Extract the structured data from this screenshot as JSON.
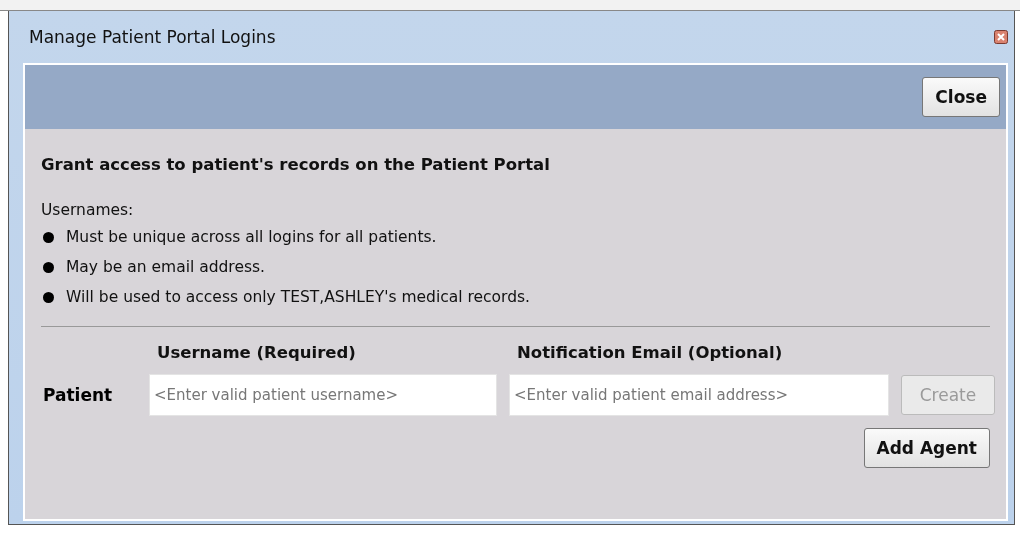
{
  "window": {
    "title": "Manage Patient Portal Logins"
  },
  "header": {
    "close_button": "Close"
  },
  "heading": "Grant access to patient's records on the Patient Portal",
  "rules_label": "Usernames:",
  "rules": [
    "Must be unique across all logins for all patients.",
    "May be an email address.",
    "Will be used to access only TEST,ASHLEY's medical records."
  ],
  "columns": [
    "Username (Required)",
    "Notification Email (Optional)"
  ],
  "row": {
    "label": "Patient",
    "username": {
      "placeholder": "<Enter valid patient username>"
    },
    "email": {
      "placeholder": "<Enter valid patient email address>"
    },
    "create_button": {
      "label": "Create",
      "disabled": true
    }
  },
  "add_agent_button": "Add Agent"
}
